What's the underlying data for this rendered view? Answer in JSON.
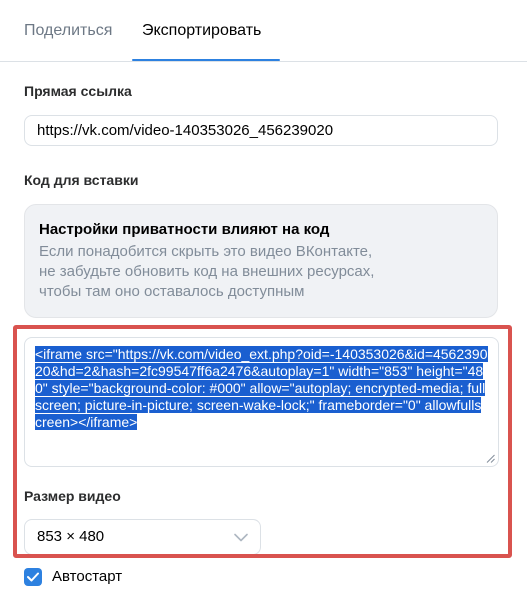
{
  "tabs": [
    {
      "label": "Поделиться",
      "active": false
    },
    {
      "label": "Экспортировать",
      "active": true
    }
  ],
  "direct_link": {
    "label": "Прямая ссылка",
    "value": "https://vk.com/video-140353026_456239020"
  },
  "embed": {
    "label": "Код для вставки",
    "privacy_notice": {
      "title": "Настройки приватности влияют на код",
      "lines": [
        "Если понадобится скрыть это видео ВКонтакте,",
        "не забудьте обновить код на внешних ресурсах,",
        "чтобы там оно оставалось доступным"
      ]
    },
    "code": "<iframe src=\"https://vk.com/video_ext.php?oid=-140353026&id=456239020&hd=2&hash=2fc99547ff6a2476&autoplay=1\" width=\"853\" height=\"480\" style=\"background-color: #000\" allow=\"autoplay; encrypted-media; fullscreen; picture-in-picture; screen-wake-lock;\" frameborder=\"0\" allowfullscreen></iframe>",
    "code_selected": true
  },
  "video_size": {
    "label": "Размер видео",
    "selected": "853 × 480"
  },
  "autostart": {
    "label": "Автостарт",
    "checked": true
  },
  "colors": {
    "accent": "#2d81e0",
    "highlight_frame": "#d9534f",
    "selection": "#1a5fd0"
  },
  "icons": {
    "select": "chevron-down-icon",
    "checkbox": "checkmark-icon",
    "textarea": "resize-grip-icon"
  }
}
